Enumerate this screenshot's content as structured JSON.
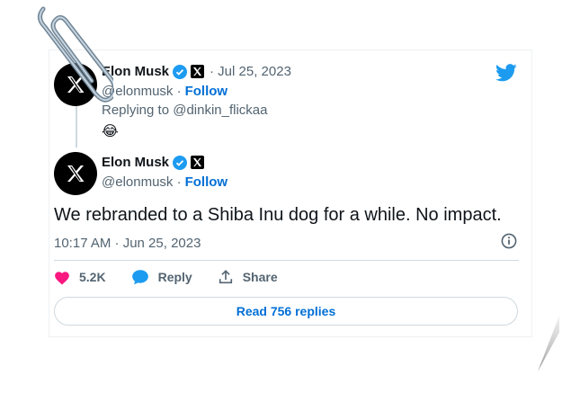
{
  "reply_tweet": {
    "author_name": "Elon Musk",
    "date": "· Jul 25, 2023",
    "handle": "@elonmusk ·",
    "follow_label": "Follow",
    "replying_to": "Replying to @dinkin_flickaa",
    "text": "😂"
  },
  "main_tweet": {
    "author_name": "Elon Musk",
    "handle": "@elonmusk ·",
    "follow_label": "Follow",
    "text": "We rebranded to a Shiba Inu dog for a while. No impact.",
    "timestamp": "10:17 AM · Jun 25, 2023"
  },
  "actions": {
    "like_count": "5.2K",
    "reply_label": "Reply",
    "share_label": "Share"
  },
  "read_replies_label": "Read 756 replies",
  "icons": {
    "brand": "twitter-bird-icon",
    "avatar": "x-logo-icon",
    "verified": "verified-badge-icon",
    "affiliate": "x-badge-icon",
    "like": "heart-icon",
    "reply": "speech-bubble-icon",
    "share": "share-arrow-icon",
    "info": "info-icon",
    "attachment": "paperclip-icon"
  },
  "colors": {
    "verified": "#1d9bf0",
    "twitter_blue": "#1d9bf0",
    "link": "#006fd6",
    "like": "#f91880",
    "muted": "#536471"
  }
}
